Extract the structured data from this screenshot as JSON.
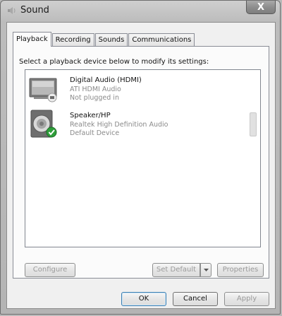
{
  "window": {
    "title": "Sound",
    "close_glyph": "X"
  },
  "tabs": [
    {
      "label": "Playback",
      "active": true
    },
    {
      "label": "Recording",
      "active": false
    },
    {
      "label": "Sounds",
      "active": false
    },
    {
      "label": "Communications",
      "active": false
    }
  ],
  "instruction": "Select a playback device below to modify its settings:",
  "devices": [
    {
      "name": "Digital Audio (HDMI)",
      "driver": "ATI HDMI Audio",
      "status": "Not plugged in",
      "icon": "monitor-speaker-icon",
      "badge": "unplugged-badge-icon"
    },
    {
      "name": "Speaker/HP",
      "driver": "Realtek High Definition Audio",
      "status": "Default Device",
      "icon": "speaker-icon",
      "badge": "default-check-badge-icon"
    }
  ],
  "buttons": {
    "configure": "Configure",
    "set_default": "Set Default",
    "properties": "Properties",
    "ok": "OK",
    "cancel": "Cancel",
    "apply": "Apply"
  },
  "colors": {
    "accent": "#3c7fb1",
    "check_badge": "#2e9e3a",
    "secondary_text": "#8a8a8a"
  }
}
